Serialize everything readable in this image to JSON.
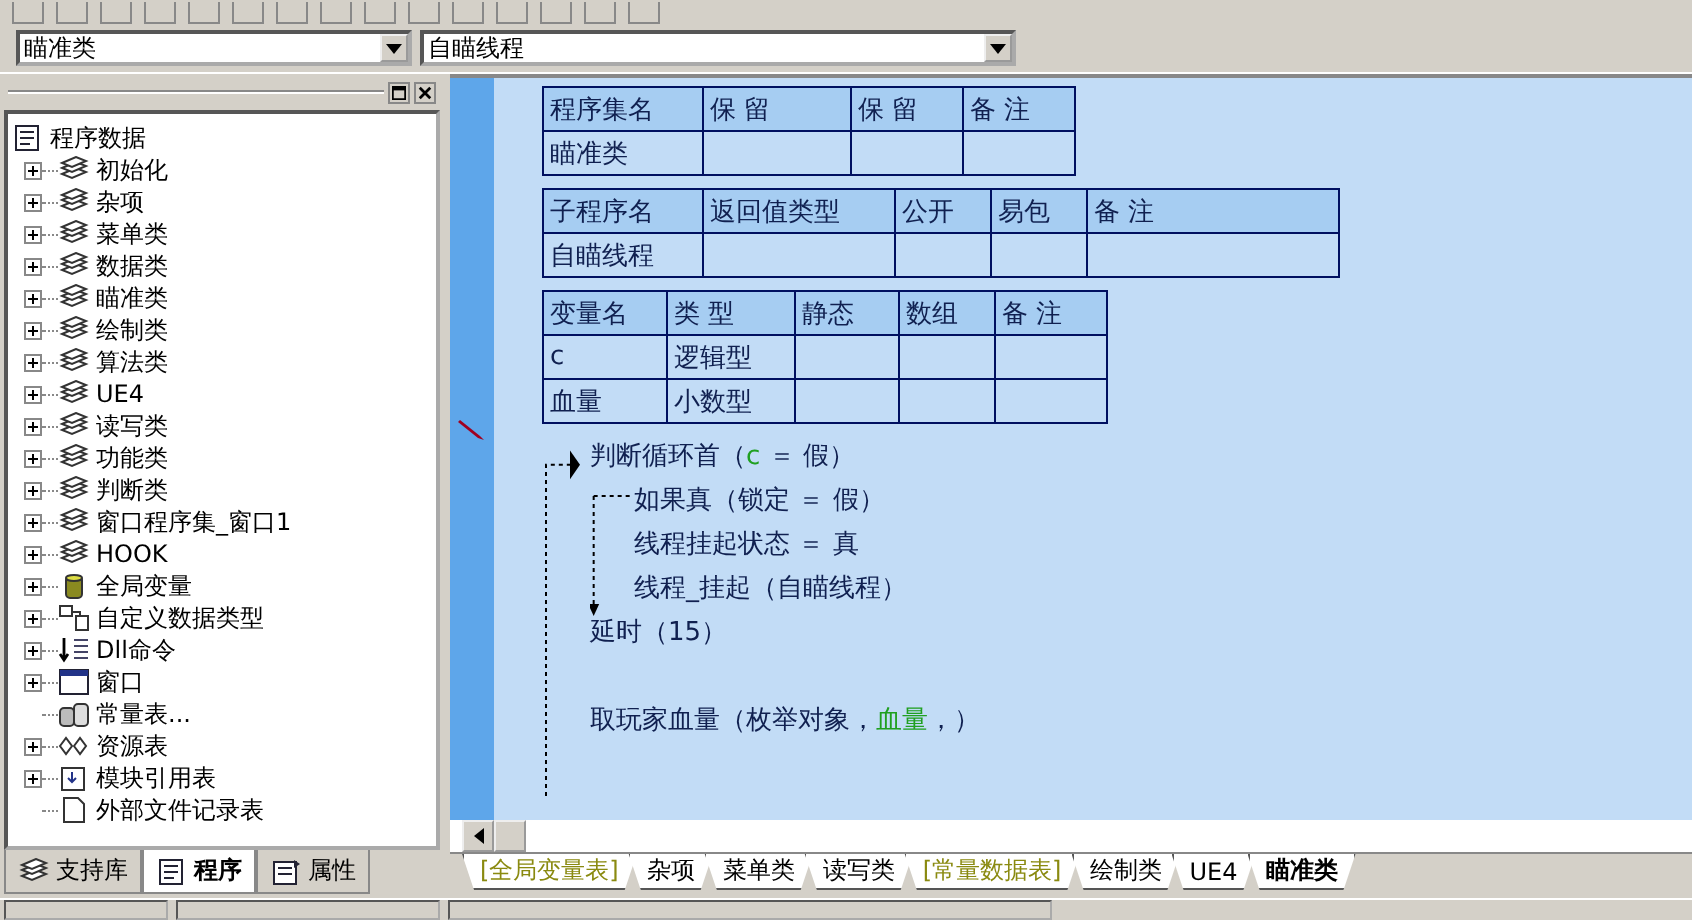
{
  "selectors": [
    {
      "value": "瞄准类"
    },
    {
      "value": "自瞄线程"
    }
  ],
  "tree": {
    "label": "程序数据",
    "kind": "program",
    "children": [
      {
        "label": "初始化",
        "kind": "library",
        "expanded": false
      },
      {
        "label": "杂项",
        "kind": "library",
        "expanded": false
      },
      {
        "label": "菜单类",
        "kind": "library",
        "expanded": false
      },
      {
        "label": "数据类",
        "kind": "library",
        "expanded": false
      },
      {
        "label": "瞄准类",
        "kind": "library",
        "expanded": false
      },
      {
        "label": "绘制类",
        "kind": "library",
        "expanded": false
      },
      {
        "label": "算法类",
        "kind": "library",
        "expanded": false
      },
      {
        "label": "UE4",
        "kind": "library",
        "expanded": false
      },
      {
        "label": "读写类",
        "kind": "library",
        "expanded": false
      },
      {
        "label": "功能类",
        "kind": "library",
        "expanded": false
      },
      {
        "label": "判断类",
        "kind": "library",
        "expanded": false
      },
      {
        "label": "窗口程序集_窗口1",
        "kind": "library",
        "expanded": false
      },
      {
        "label": "HOOK",
        "kind": "library",
        "expanded": false
      },
      {
        "label": "全局变量",
        "kind": "globals",
        "expanded": false
      },
      {
        "label": "自定义数据类型",
        "kind": "datatype",
        "expanded": false
      },
      {
        "label": "Dll命令",
        "kind": "dll",
        "expanded": false
      },
      {
        "label": "窗口",
        "kind": "window",
        "expanded": false
      },
      {
        "label": "常量表...",
        "kind": "constants"
      },
      {
        "label": "资源表",
        "kind": "resources",
        "expanded": false
      },
      {
        "label": "模块引用表",
        "kind": "module",
        "expanded": false
      },
      {
        "label": "外部文件记录表",
        "kind": "file"
      }
    ]
  },
  "panel_tabs": [
    {
      "label": "支持库",
      "kind": "library",
      "selected": false
    },
    {
      "label": "程序",
      "kind": "program",
      "selected": true
    },
    {
      "label": "属性",
      "kind": "properties",
      "selected": false
    }
  ],
  "tables": [
    {
      "columns": [
        "程序集名",
        "保 留",
        "保 留",
        "备 注"
      ],
      "rows": [
        [
          "瞄准类"
        ]
      ]
    },
    {
      "columns": [
        "子程序名",
        "返回值类型",
        "公开",
        "易包",
        "备 注"
      ],
      "rows": [
        [
          "自瞄线程"
        ]
      ]
    },
    {
      "columns": [
        "变量名",
        "类 型",
        "静态",
        "数组",
        "备 注"
      ],
      "rows": [
        [
          "c",
          "逻辑型"
        ],
        [
          "血量",
          "小数型"
        ]
      ]
    }
  ],
  "code": [
    {
      "kind": "loop",
      "parts": [
        {
          "text": "判断循环首（"
        },
        {
          "text": "c",
          "highlight": true
        },
        {
          "text": " ＝ 假）"
        }
      ],
      "children": [
        {
          "kind": "if",
          "parts": [
            {
              "text": "如果真（锁定 ＝ 假）"
            }
          ],
          "children": [
            {
              "kind": "statement",
              "parts": [
                {
                  "text": "线程挂起状态 ＝ 真"
                }
              ]
            },
            {
              "kind": "statement",
              "parts": [
                {
                  "text": "线程_挂起（自瞄线程）"
                }
              ]
            }
          ]
        },
        {
          "kind": "statement",
          "parts": [
            {
              "text": "延时（15）"
            }
          ]
        },
        {
          "kind": "blank"
        },
        {
          "kind": "statement",
          "parts": [
            {
              "text": "取玩家血量（枚举对象，"
            },
            {
              "text": "血量",
              "highlight": true
            },
            {
              "text": "，）"
            }
          ]
        }
      ]
    }
  ],
  "doc_tabs": [
    {
      "label": "[全局变量表]",
      "kind": "table",
      "selected": false
    },
    {
      "label": "杂项",
      "kind": "class",
      "selected": false
    },
    {
      "label": "菜单类",
      "kind": "class",
      "selected": false
    },
    {
      "label": "读写类",
      "kind": "class",
      "selected": false
    },
    {
      "label": "[常量数据表]",
      "kind": "table",
      "selected": false
    },
    {
      "label": "绘制类",
      "kind": "class",
      "selected": false
    },
    {
      "label": "UE4",
      "kind": "class",
      "selected": false
    },
    {
      "label": "瞄准类",
      "kind": "class",
      "selected": true
    }
  ]
}
